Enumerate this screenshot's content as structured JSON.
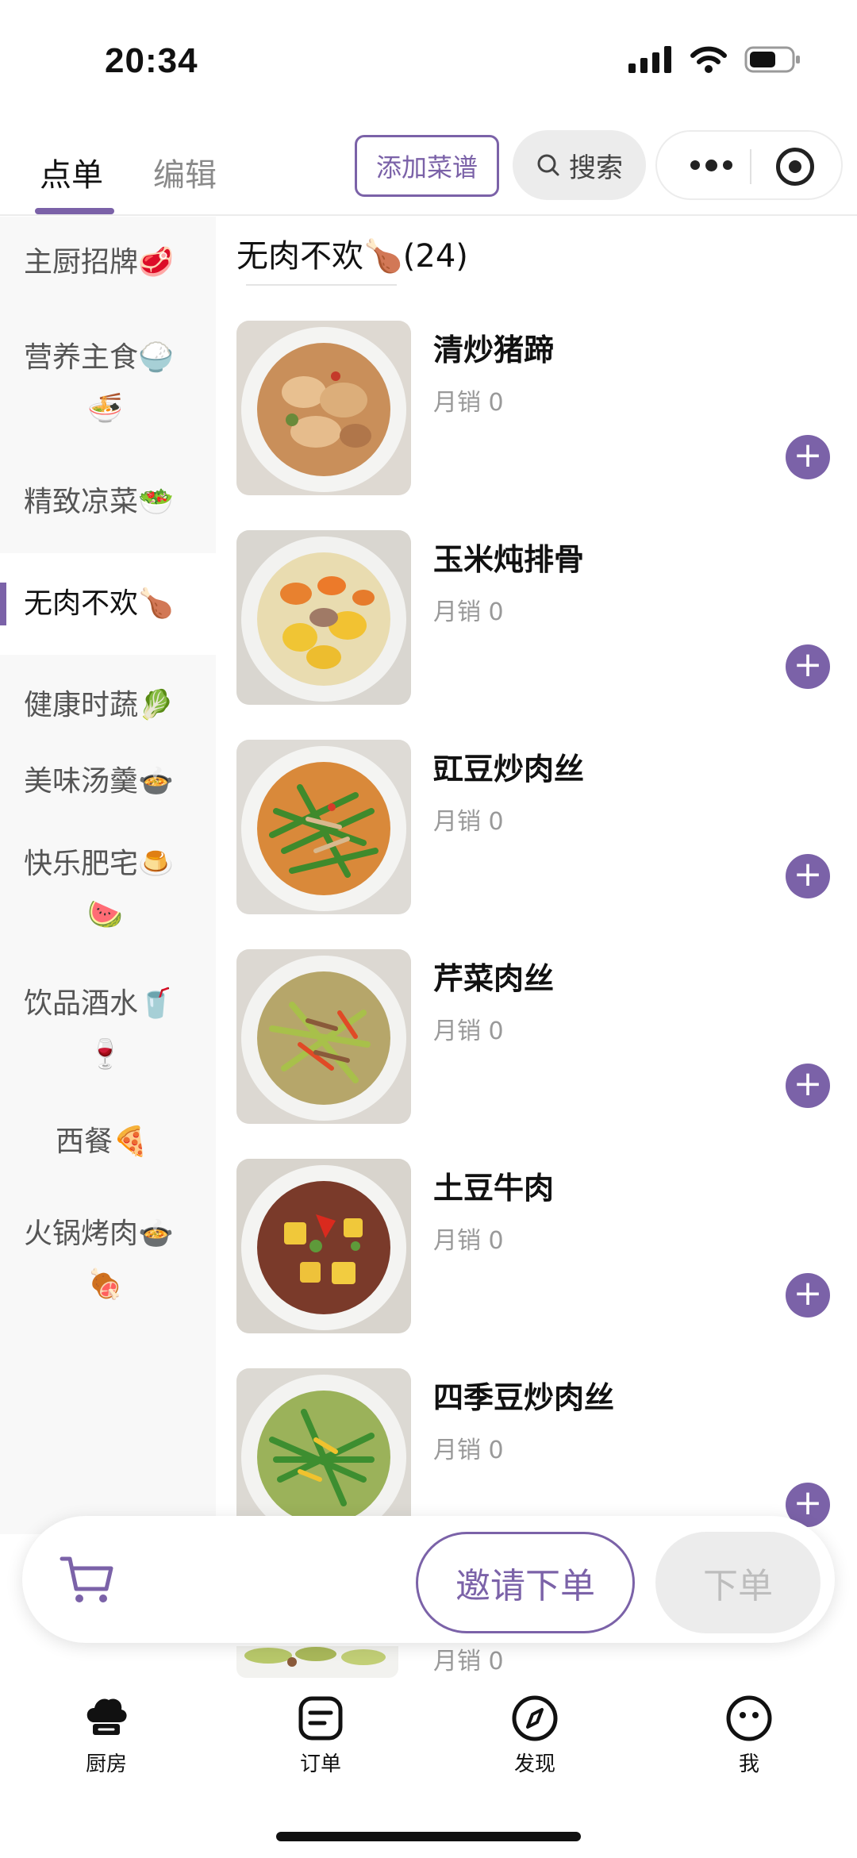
{
  "status_bar": {
    "time": "20:34"
  },
  "header": {
    "tabs": [
      {
        "label": "点单"
      },
      {
        "label": "编辑"
      }
    ],
    "add_recipe_label": "添加菜谱",
    "search_label": "搜索"
  },
  "sidebar": {
    "categories": [
      {
        "label": "主厨招牌🥩"
      },
      {
        "label": "营养主食🍚",
        "label2": "🍜"
      },
      {
        "label": "精致凉菜🥗"
      },
      {
        "label": "无肉不欢🍗",
        "active": true
      },
      {
        "label": "健康时蔬🥬"
      },
      {
        "label": "美味汤羹🍲"
      },
      {
        "label": "快乐肥宅🍮",
        "label2": "🍉"
      },
      {
        "label": "饮品酒水🥤",
        "label2": "🍷"
      },
      {
        "label": "西餐🍕"
      },
      {
        "label": "火锅烤肉🍲",
        "label2": "🍖"
      }
    ]
  },
  "section": {
    "title": "无肉不欢🍗(24)"
  },
  "dishes": [
    {
      "name": "清炒猪蹄",
      "sales": "月销 0",
      "food": "pork-trotter"
    },
    {
      "name": "玉米炖排骨",
      "sales": "月销 0",
      "food": "corn-ribs"
    },
    {
      "name": "豇豆炒肉丝",
      "sales": "月销 0",
      "food": "long-bean-pork"
    },
    {
      "name": "芹菜肉丝",
      "sales": "月销 0",
      "food": "celery-pork"
    },
    {
      "name": "土豆牛肉",
      "sales": "月销 0",
      "food": "potato-beef"
    },
    {
      "name": "四季豆炒肉丝",
      "sales": "月销 0",
      "food": "green-bean-pork"
    }
  ],
  "partial_dish": {
    "sales": "月销 0"
  },
  "cart_bar": {
    "invite_label": "邀请下单",
    "order_label": "下单"
  },
  "bottom_nav": {
    "items": [
      {
        "label": "厨房",
        "icon": "chef-hat-icon"
      },
      {
        "label": "订单",
        "icon": "order-icon"
      },
      {
        "label": "发现",
        "icon": "compass-icon"
      },
      {
        "label": "我",
        "icon": "face-icon"
      }
    ]
  },
  "colors": {
    "accent": "#7b62a8",
    "sidebar_bg": "#f8f8f8",
    "muted_text": "#999999"
  }
}
